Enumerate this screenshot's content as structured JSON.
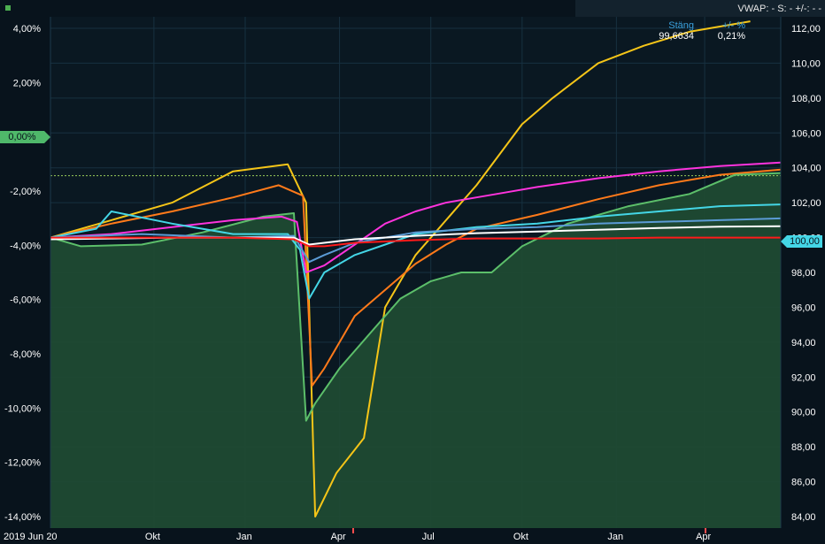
{
  "header": {
    "symbol": "",
    "vwap_label": "VWAP: -  S: -  +/-: -  -"
  },
  "quote": {
    "close_label": "Stäng",
    "close_value": "99,6634",
    "change_label": "+/- %",
    "change_value": "0,21%"
  },
  "badges": {
    "left_value": "0,00%",
    "right_value": "100,00"
  },
  "chart_data": {
    "type": "line",
    "title": "",
    "xlabel": "",
    "ylabel": "",
    "x_ticks": [
      "2019 Jun 20",
      "Okt",
      "Jan",
      "Apr",
      "Jul",
      "Okt",
      "Jan",
      "Apr"
    ],
    "y_left_ticks": [
      "4,00%",
      "2,00%",
      "0,00%",
      "-2,00%",
      "-4,00%",
      "-6,00%",
      "-8,00%",
      "-10,00%",
      "-12,00%",
      "-14,00%"
    ],
    "y_right_ticks": [
      "112,00",
      "110,00",
      "108,00",
      "106,00",
      "104,00",
      "102,00",
      "100,00",
      "98,00",
      "96,00",
      "94,00",
      "92,00",
      "90,00",
      "88,00",
      "86,00",
      "84,00"
    ],
    "y_left_range": [
      -14,
      4
    ],
    "y_right_range": [
      84,
      112
    ],
    "x_range_months": [
      0,
      24
    ],
    "series": [
      {
        "color": "#f5c518",
        "x": [
          0,
          2,
          4,
          6,
          7.8,
          8.4,
          8.7,
          9.4,
          10.3,
          11,
          12,
          13,
          14,
          15.5,
          16.5,
          18,
          19.5,
          21,
          23
        ],
        "y": [
          100,
          101,
          102,
          103.8,
          104.2,
          102,
          84,
          86.5,
          88.5,
          96,
          99,
          101,
          103,
          106.5,
          108,
          110,
          111,
          111.8,
          112.4
        ]
      },
      {
        "color": "#ff7a1a",
        "x": [
          0,
          2,
          4,
          6,
          7.5,
          8.3,
          8.6,
          9,
          10,
          11,
          12,
          13,
          14,
          16,
          18,
          20,
          22,
          24
        ],
        "y": [
          100,
          100.8,
          101.5,
          102.3,
          103,
          102.4,
          91.5,
          92.5,
          95.5,
          97,
          98.5,
          99.6,
          100.5,
          101.3,
          102.2,
          103,
          103.6,
          103.9
        ]
      },
      {
        "color": "#5cbf6a",
        "x": [
          0,
          1,
          3,
          5,
          7,
          8,
          8.4,
          8.7,
          9.5,
          10.5,
          11.5,
          12.5,
          13.5,
          14.5,
          15.5,
          17,
          19,
          21,
          22.5,
          24
        ],
        "y": [
          100,
          99.5,
          99.6,
          100.3,
          101.2,
          101.4,
          89.5,
          90.5,
          92.5,
          94.5,
          96.5,
          97.5,
          98,
          98,
          99.5,
          100.8,
          101.8,
          102.5,
          103.6,
          103.7
        ]
      },
      {
        "color": "#ff33dd",
        "x": [
          0,
          2,
          4,
          6,
          7.6,
          8.1,
          8.4,
          9,
          10,
          11,
          12,
          13,
          14,
          15,
          16,
          18,
          20,
          22,
          24
        ],
        "y": [
          100,
          100.2,
          100.6,
          101,
          101.2,
          100.9,
          98,
          98.4,
          99.6,
          100.8,
          101.5,
          102,
          102.3,
          102.6,
          102.9,
          103.4,
          103.8,
          104.1,
          104.3
        ]
      },
      {
        "color": "#44d6e6",
        "x": [
          0,
          1.5,
          2,
          4,
          6,
          7.8,
          8.2,
          8.5,
          9,
          10,
          11,
          12,
          13,
          14,
          16,
          18,
          20,
          22,
          24
        ],
        "y": [
          100,
          100.5,
          101.5,
          100.8,
          100.2,
          100.2,
          99.3,
          96.5,
          98,
          99,
          99.6,
          100.2,
          100.4,
          100.6,
          100.8,
          101.2,
          101.5,
          101.8,
          101.9
        ]
      },
      {
        "color": "#5b9bd5",
        "x": [
          0,
          3,
          6,
          8,
          8.5,
          9,
          10,
          12,
          14,
          16,
          18,
          20,
          22,
          24
        ],
        "y": [
          100,
          100.2,
          100,
          100.1,
          98.6,
          99,
          99.7,
          100.3,
          100.5,
          100.6,
          100.8,
          100.9,
          101,
          101.1
        ]
      },
      {
        "color": "#ffffff",
        "x": [
          0,
          2,
          4,
          6,
          8,
          8.5,
          9,
          10,
          12,
          14,
          16,
          18,
          20,
          22,
          24
        ],
        "y": [
          99.9,
          99.95,
          100,
          100,
          100,
          99.6,
          99.7,
          99.9,
          100.1,
          100.25,
          100.35,
          100.45,
          100.55,
          100.62,
          100.65
        ]
      },
      {
        "color": "#ff1a1a",
        "x": [
          0,
          2,
          4,
          6,
          8,
          8.5,
          9,
          10,
          12,
          14,
          16,
          18,
          20,
          22,
          24
        ],
        "y": [
          100,
          100,
          100,
          100,
          99.9,
          99.5,
          99.5,
          99.7,
          99.85,
          99.95,
          99.95,
          99.95,
          100,
          100,
          100
        ]
      }
    ]
  }
}
